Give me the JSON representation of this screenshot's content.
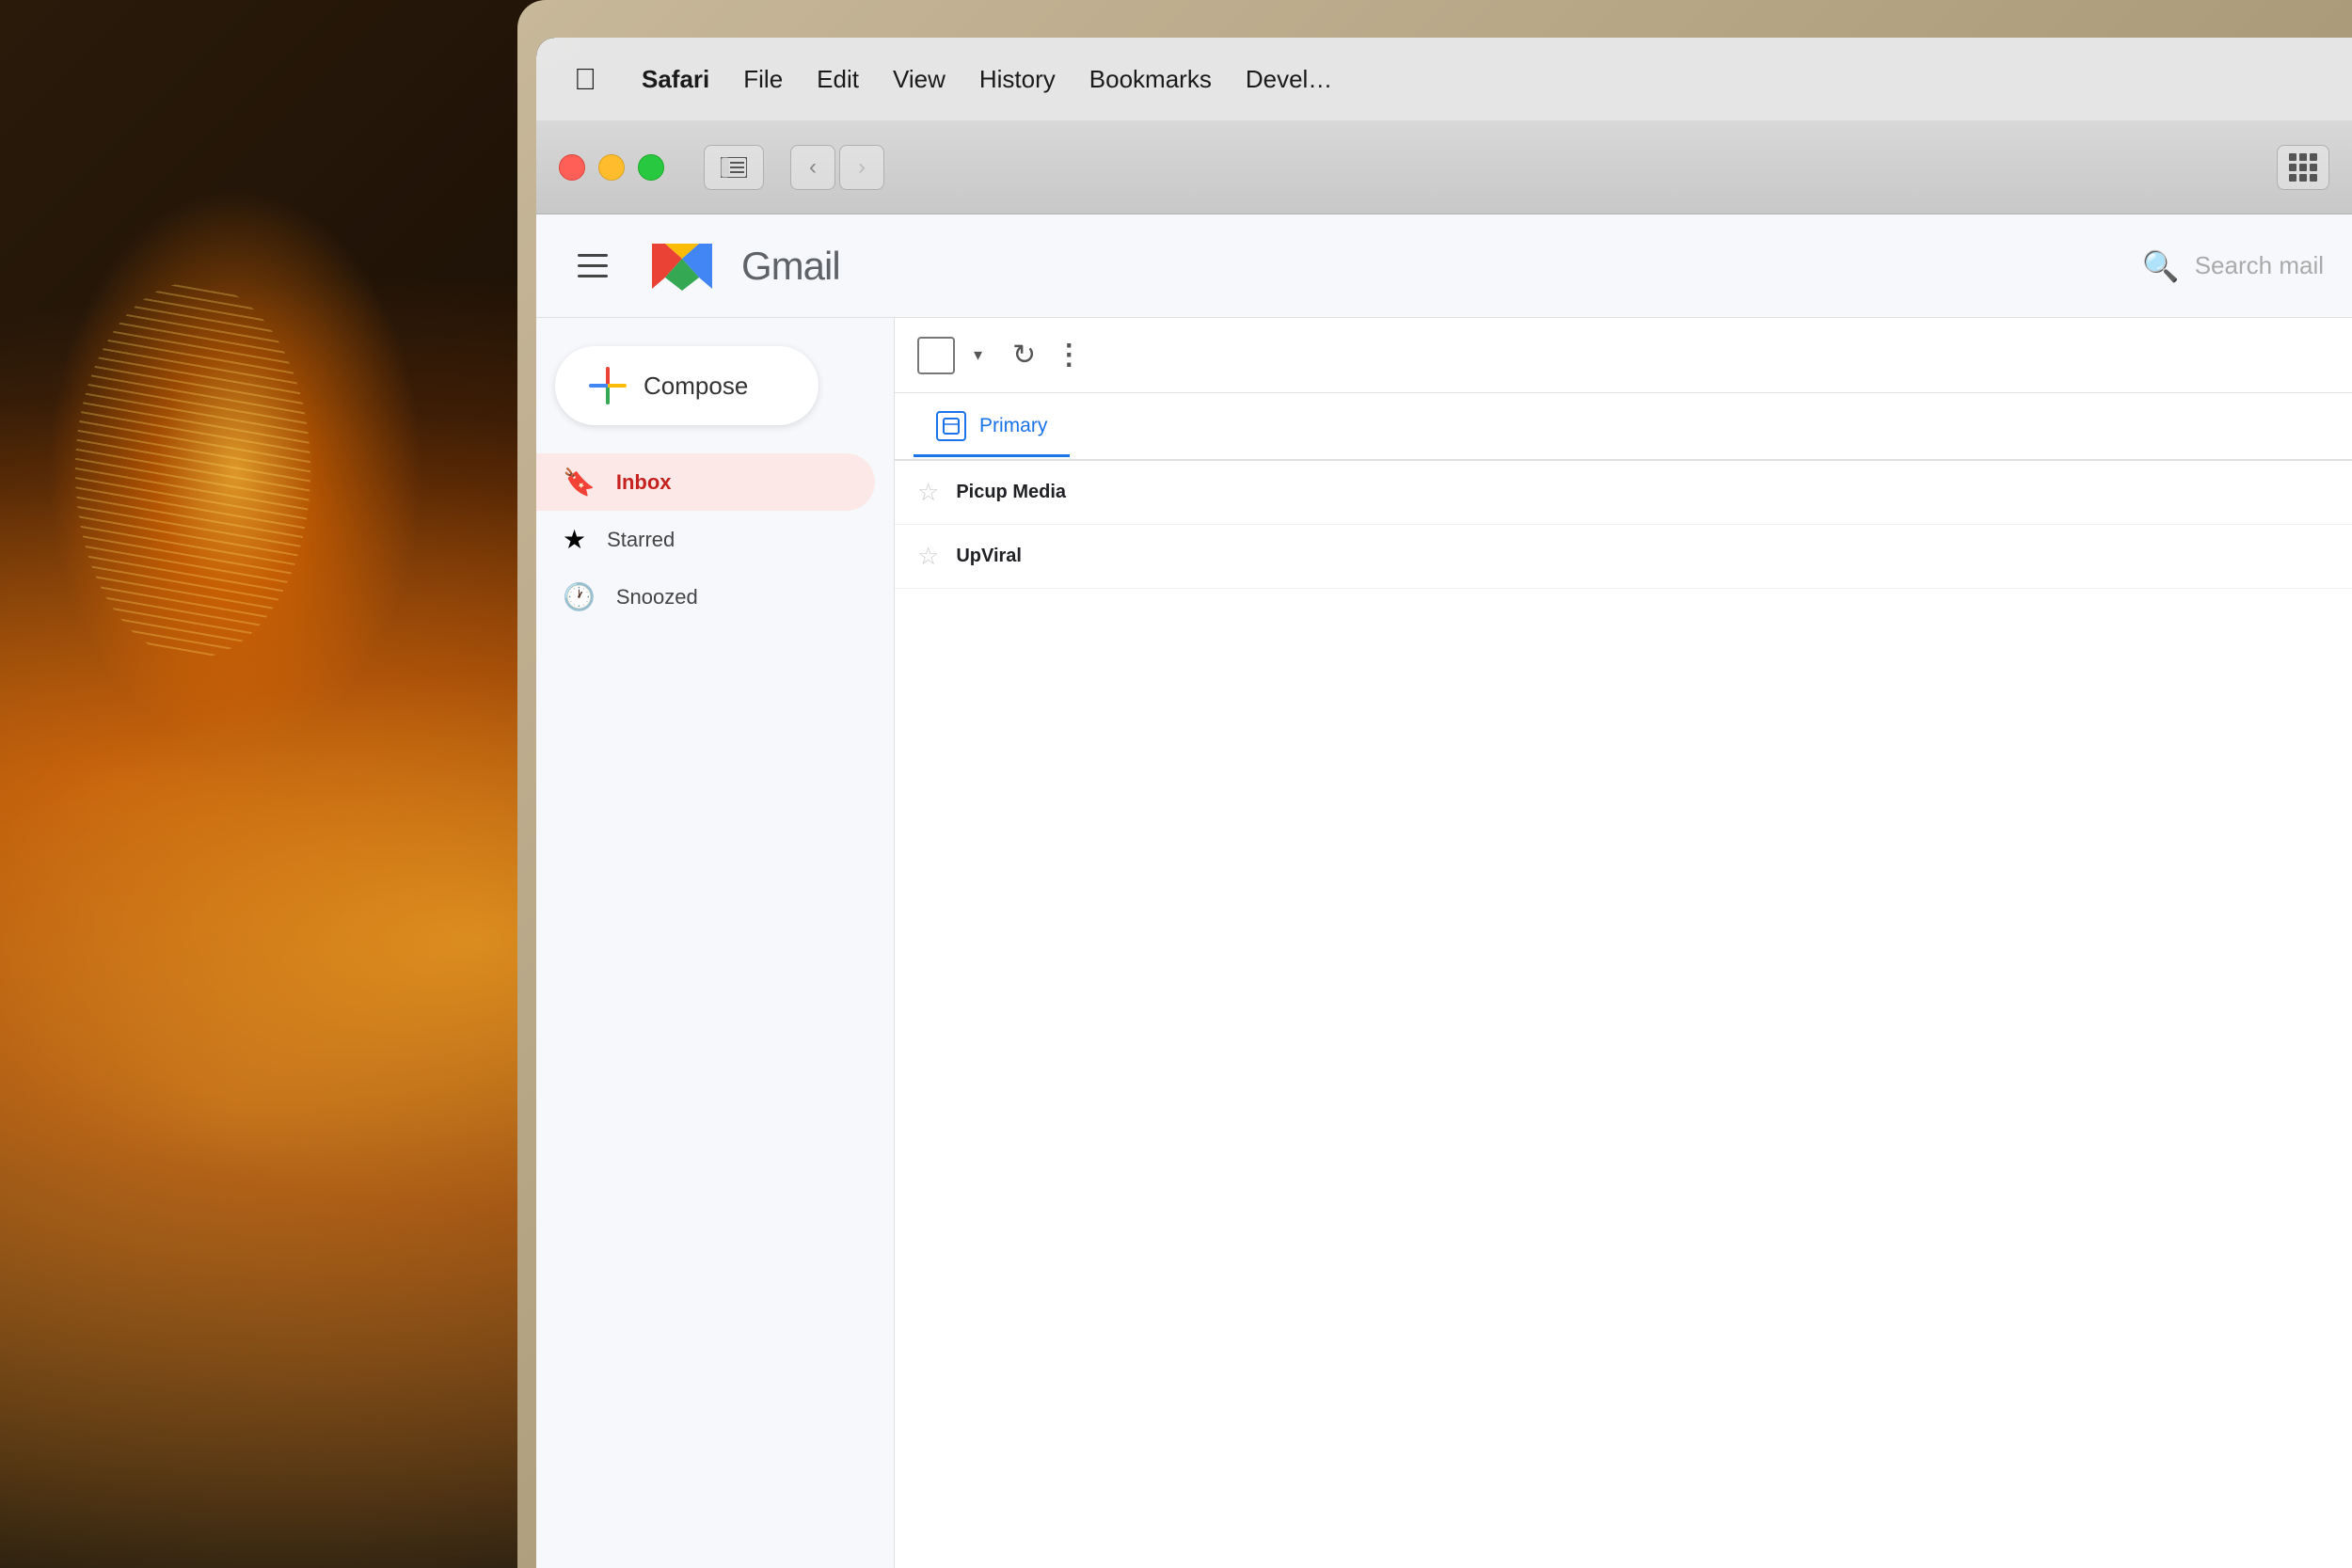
{
  "background": {
    "color": "#1a1a1a"
  },
  "macos_menubar": {
    "apple_icon": "🍎",
    "items": [
      {
        "label": "Safari",
        "bold": true
      },
      {
        "label": "File",
        "bold": false
      },
      {
        "label": "Edit",
        "bold": false
      },
      {
        "label": "View",
        "bold": false
      },
      {
        "label": "History",
        "bold": false
      },
      {
        "label": "Bookmarks",
        "bold": false
      },
      {
        "label": "Devel…",
        "bold": false
      }
    ]
  },
  "browser_chrome": {
    "nav_back": "‹",
    "nav_forward": "›",
    "sidebar_icon": "⊟"
  },
  "gmail": {
    "header": {
      "menu_icon": "≡",
      "logo_text": "Gmail",
      "search_placeholder": "Search mail"
    },
    "compose": {
      "label": "Compose"
    },
    "nav_items": [
      {
        "id": "inbox",
        "label": "Inbox",
        "icon": "🔖",
        "active": true
      },
      {
        "id": "starred",
        "label": "Starred",
        "icon": "★",
        "active": false
      },
      {
        "id": "snoozed",
        "label": "Snoozed",
        "icon": "🕐",
        "active": false
      }
    ],
    "toolbar": {
      "more_dots": "⋮"
    },
    "tabs": [
      {
        "id": "primary",
        "label": "Primary",
        "active": true
      }
    ],
    "email_rows": [
      {
        "sender": "Picup Media",
        "starred": false
      },
      {
        "sender": "UpViral",
        "starred": false
      }
    ]
  }
}
